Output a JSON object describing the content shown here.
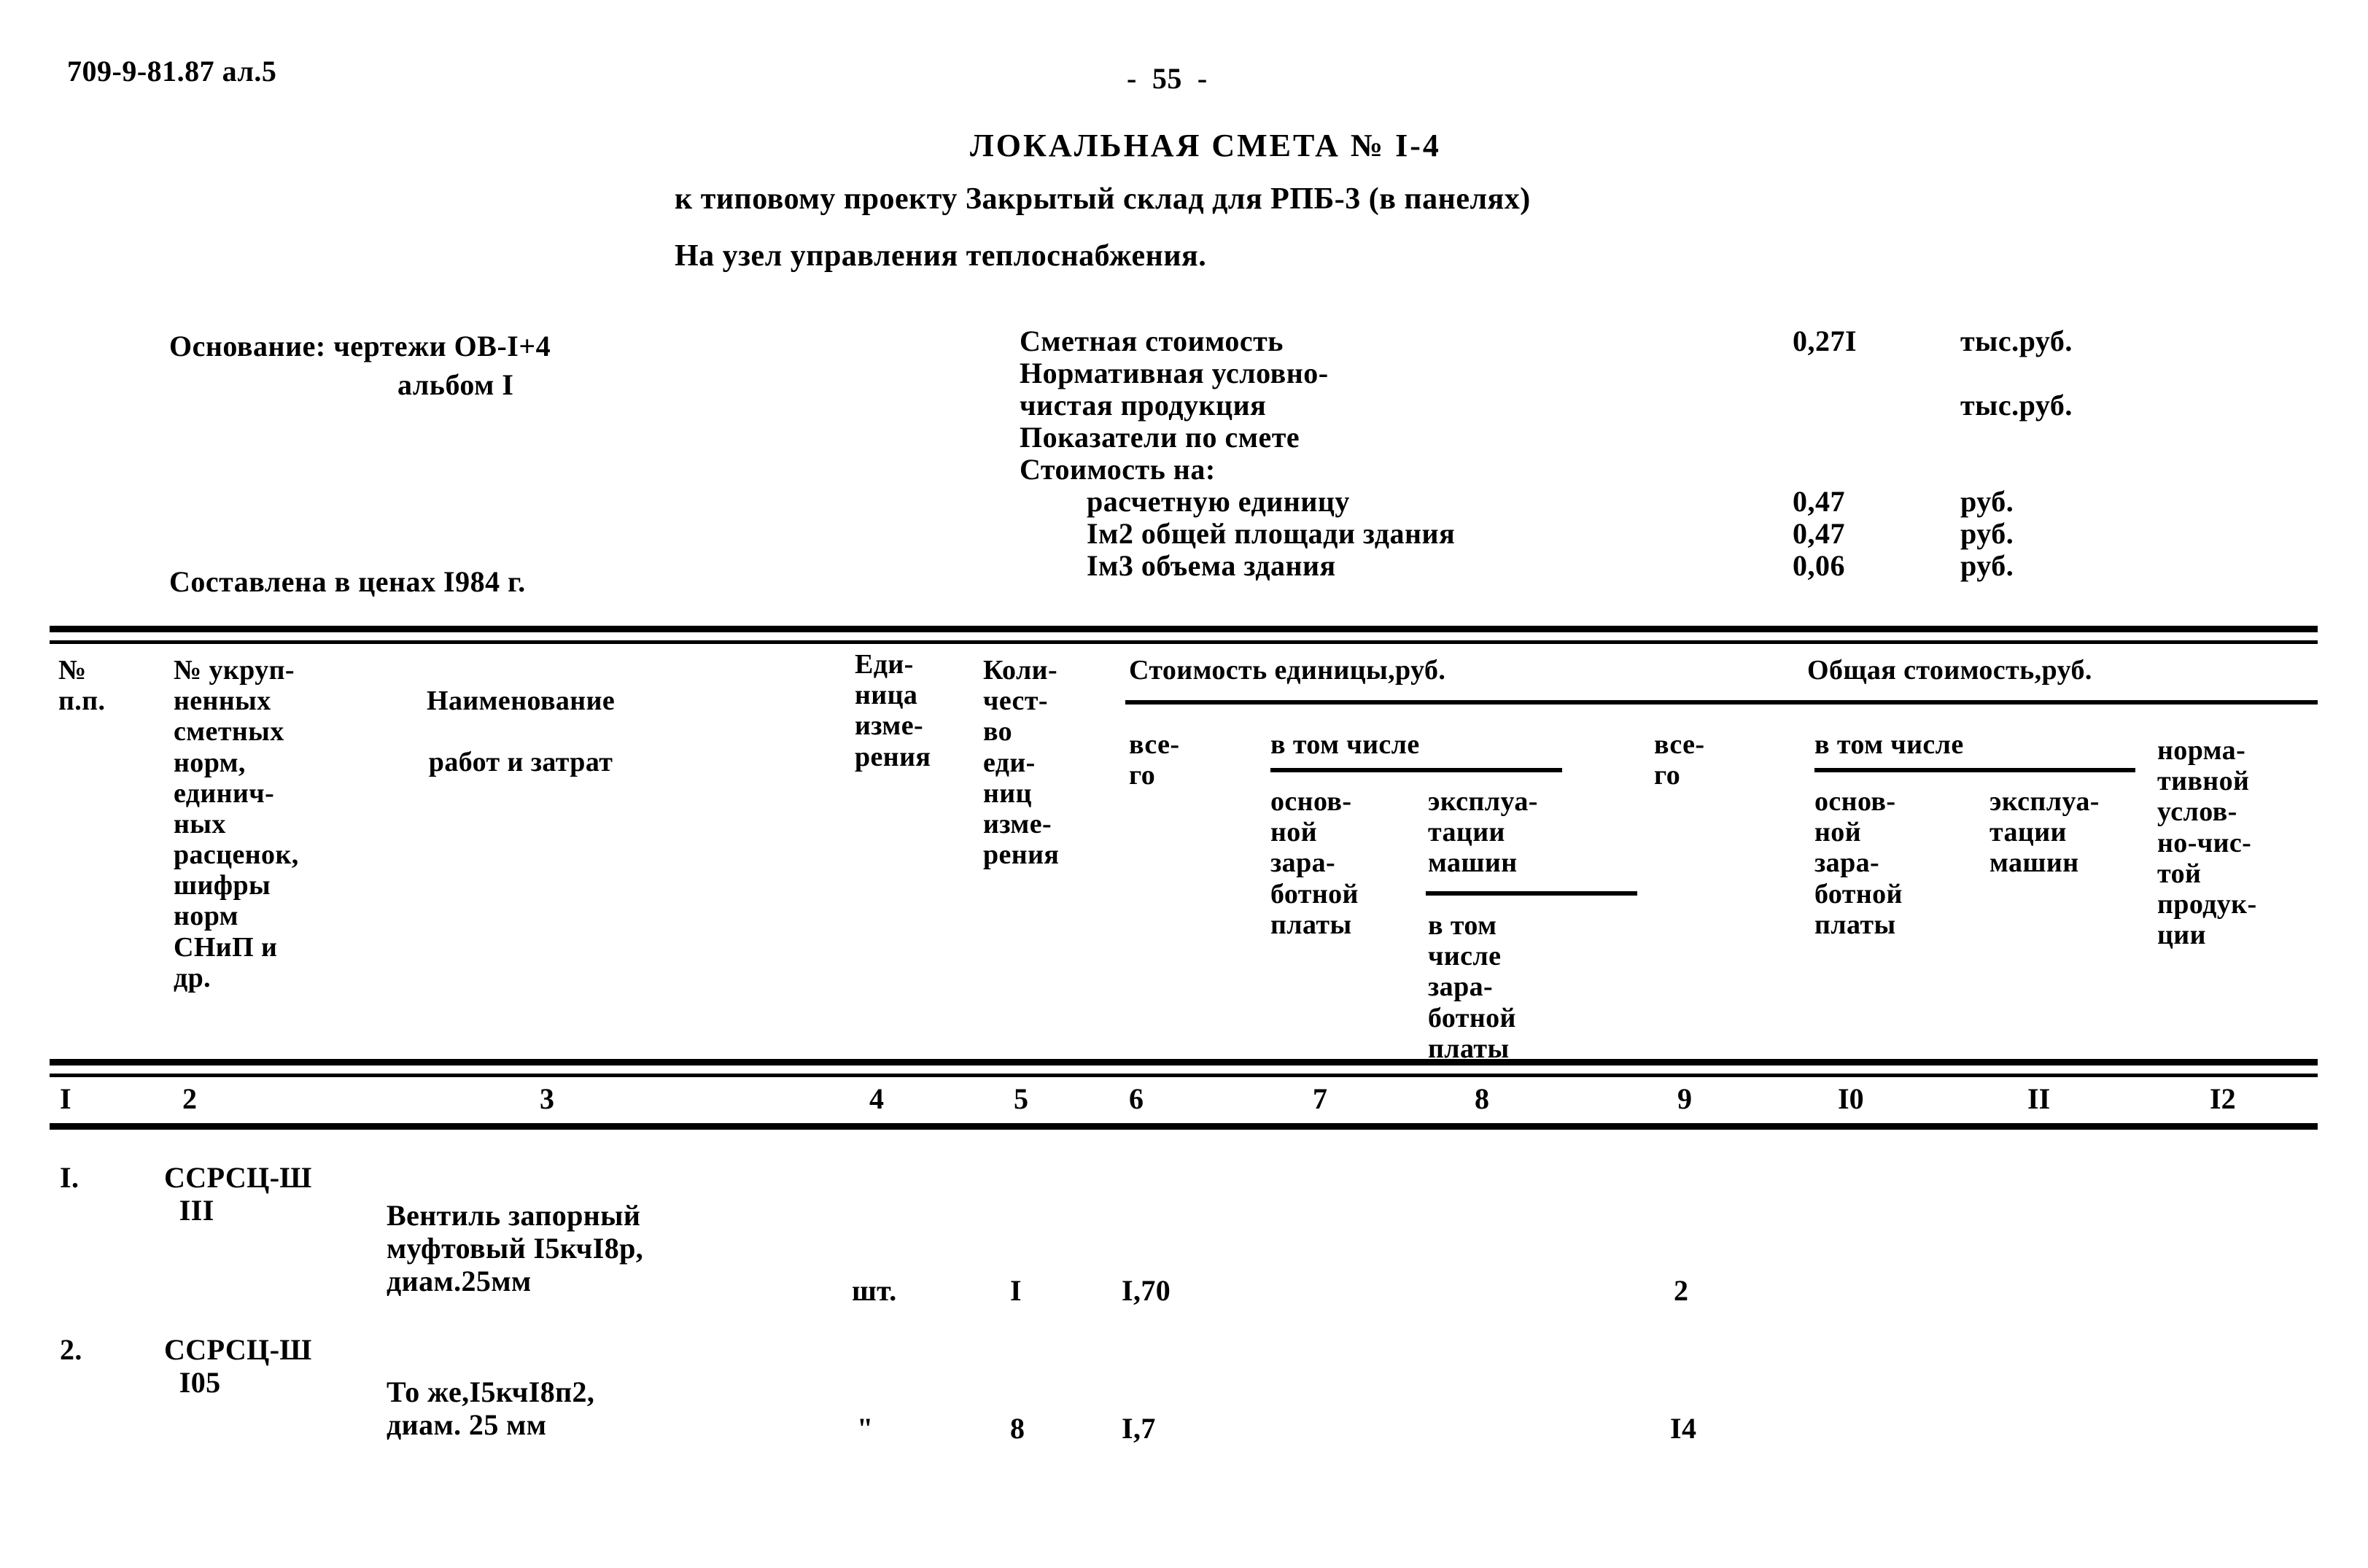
{
  "document": {
    "code": "709-9-81.87 ал.5",
    "page_number": "-  55  -",
    "title": "ЛОКАЛЬНАЯ СМЕТА № I-4",
    "subtitle_1": "к типовому проекту Закрытый склад для РПБ-3 (в панелях)",
    "subtitle_2": "На узел управления теплоснабжения."
  },
  "basis": {
    "label": "Основание: чертежи ОВ-I+4",
    "line_2": "альбом I",
    "compiled": "Составлена в ценах I984 г."
  },
  "summary": [
    {
      "label": "Сметная стоимость",
      "indent": false,
      "value": "0,27I",
      "unit": "тыс.руб."
    },
    {
      "label": "Нормативная условно-",
      "indent": false,
      "value": "",
      "unit": ""
    },
    {
      "label": "чистая продукция",
      "indent": false,
      "value": "",
      "unit": "тыс.руб."
    },
    {
      "label": "Показатели по смете",
      "indent": false,
      "value": "",
      "unit": ""
    },
    {
      "label": "Стоимость на:",
      "indent": false,
      "value": "",
      "unit": ""
    },
    {
      "label": "расчетную единицу",
      "indent": true,
      "value": "0,47",
      "unit": "руб."
    },
    {
      "label": "Iм2 общей площади здания",
      "indent": true,
      "value": "0,47",
      "unit": "руб."
    },
    {
      "label": "Iм3 объема здания",
      "indent": true,
      "value": "0,06",
      "unit": "руб."
    }
  ],
  "table": {
    "headers": {
      "col1": "№\nп.п.",
      "col2": "№ укруп-\nненных\nсметных\nнорм,\nединич-\nных\nрасценок,\nшифры\nнорм\nСНиП и\nдр.",
      "col3": "Наименование\n\nработ и затрат",
      "col4": "Еди-\nница\nизме-\nрения",
      "col5": "Коли-\nчест-\nво\nеди-\nниц\nизме-\nрения",
      "group_unit_cost": "Стоимость единицы,руб.",
      "col6": "все-\nго",
      "sub_incl_1": "в том числе",
      "col7": "основ-\nной\nзара-\nботной\nплаты",
      "col8": "эксплуа-\nтации\nмашин",
      "col8_sub": "в том\nчисле\nзара-\nботной\nплаты",
      "group_total_cost": "Общая стоимость,руб.",
      "col9": "все-\nго",
      "sub_incl_2": "в том числе",
      "col10": "основ-\nной\nзара-\nботной\nплаты",
      "col11": "эксплуа-\nтации\nмашин",
      "col12": "норма-\nтивной\nуслов-\nно-чис-\nтой\nпродук-\nции"
    },
    "column_numbers": [
      "I",
      "2",
      "3",
      "4",
      "5",
      "6",
      "7",
      "8",
      "9",
      "I0",
      "II",
      "I2"
    ],
    "rows": [
      {
        "no": "I.",
        "norm_code": "ССРСЦ-Ш\n  III",
        "description": "Вентиль запорный\nмуфтовый I5кчI8р,\nдиам.25мм",
        "unit": "шт.",
        "quantity": "I",
        "unit_total": "I,70",
        "unit_wage": "",
        "unit_machine": "",
        "total": "2",
        "total_wage": "",
        "total_machine": "",
        "normative": ""
      },
      {
        "no": "2.",
        "norm_code": "ССРСЦ-Ш\n  I05",
        "description": "То же,I5кчI8п2,\nдиам. 25 мм",
        "unit": "\"",
        "quantity": "8",
        "unit_total": "I,7",
        "unit_wage": "",
        "unit_machine": "",
        "total": "I4",
        "total_wage": "",
        "total_machine": "",
        "normative": ""
      }
    ]
  }
}
